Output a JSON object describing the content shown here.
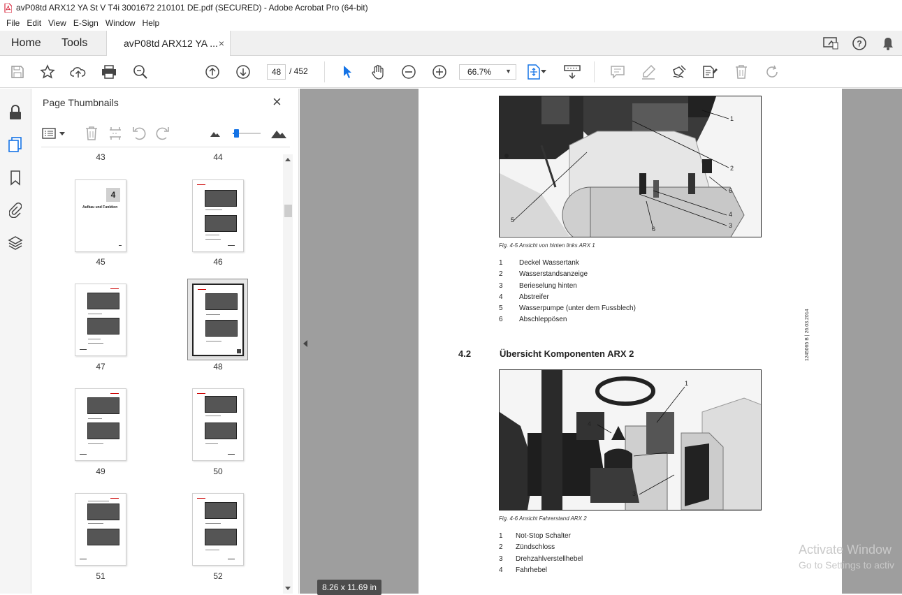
{
  "window": {
    "title": "avP08td ARX12 YA St V T4i 3001672 210101 DE.pdf (SECURED) - Adobe Acrobat Pro (64-bit)"
  },
  "menu": [
    "File",
    "Edit",
    "View",
    "E-Sign",
    "Window",
    "Help"
  ],
  "tabs": {
    "home": "Home",
    "tools": "Tools",
    "doc": "avP08td ARX12 YA ...",
    "doc_close": "×"
  },
  "toolbar": {
    "page_current": "48",
    "page_total": "/ 452",
    "zoom": "66.7%"
  },
  "panel": {
    "title": "Page Thumbnails",
    "close": "×"
  },
  "thumbnails": [
    {
      "label": "43"
    },
    {
      "label": "44"
    },
    {
      "label": "45"
    },
    {
      "label": "46"
    },
    {
      "label": "47"
    },
    {
      "label": "48"
    },
    {
      "label": "49"
    },
    {
      "label": "50"
    },
    {
      "label": "51"
    },
    {
      "label": "52"
    }
  ],
  "chapter_thumb": {
    "number": "4",
    "title": "Aufbau und Funktion"
  },
  "page": {
    "fig5_caption": "Fig. 4-5 Ansicht von hinten links ARX 1",
    "fig5_callouts": [
      "1",
      "2",
      "6",
      "4",
      "3",
      "6",
      "5"
    ],
    "fig5_legend": [
      {
        "n": "1",
        "t": "Deckel Wassertank"
      },
      {
        "n": "2",
        "t": "Wasserstandsanzeige"
      },
      {
        "n": "3",
        "t": "Berieselung hinten"
      },
      {
        "n": "4",
        "t": "Abstreifer"
      },
      {
        "n": "5",
        "t": "Wasserpumpe (unter dem Fussblech)"
      },
      {
        "n": "6",
        "t": "Abschleppösen"
      }
    ],
    "section_number": "4.2",
    "section_title": "Übersicht Komponenten ARX 2",
    "fig6_caption": "Fig. 4-6 Ansicht Fahrerstand ARX 2",
    "fig6_callouts": [
      "1",
      "4",
      "2",
      "3"
    ],
    "fig6_legend": [
      {
        "n": "1",
        "t": "Not-Stop Schalter"
      },
      {
        "n": "2",
        "t": "Zündschloss"
      },
      {
        "n": "3",
        "t": "Drehzahlverstellhebel"
      },
      {
        "n": "4",
        "t": "Fahrhebel"
      }
    ],
    "side_code": "1245065 B | 26.03.2014"
  },
  "status": {
    "page_size": "8.26 x 11.69 in"
  },
  "watermark": {
    "line1": "Activate Window",
    "line2": "Go to Settings to activ"
  }
}
